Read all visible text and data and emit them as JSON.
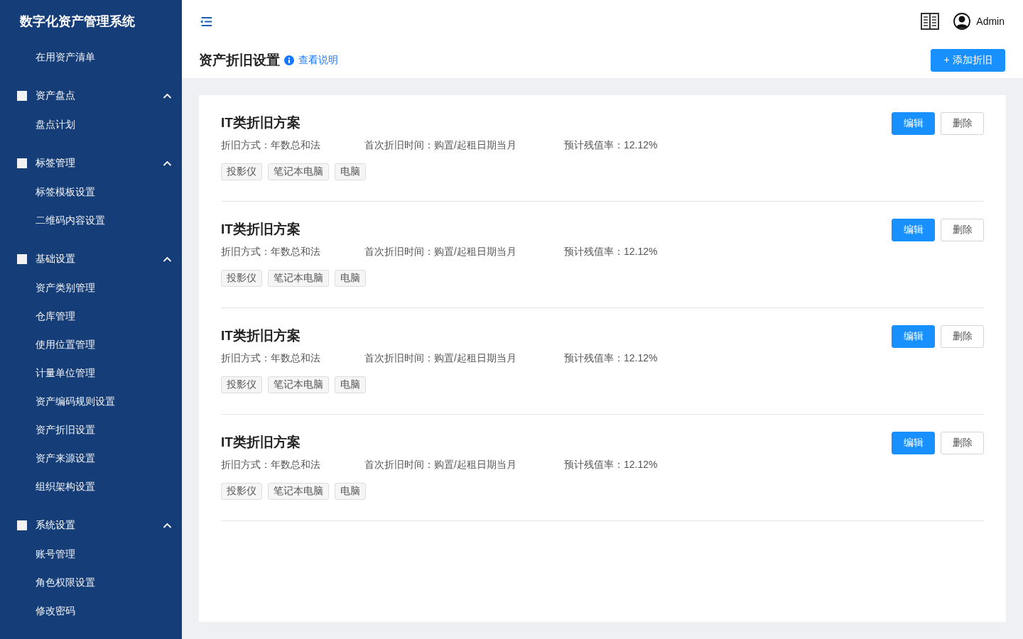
{
  "sidebar": {
    "title": "数字化资产管理系统",
    "items": [
      {
        "kind": "link",
        "label": "在用资产清单"
      },
      {
        "kind": "group",
        "label": "资产盘点",
        "expanded": true,
        "children": [
          {
            "label": "盘点计划"
          }
        ]
      },
      {
        "kind": "group",
        "label": "标签管理",
        "expanded": true,
        "children": [
          {
            "label": "标签模板设置"
          },
          {
            "label": "二维码内容设置"
          }
        ]
      },
      {
        "kind": "group",
        "label": "基础设置",
        "expanded": true,
        "children": [
          {
            "label": "资产类别管理"
          },
          {
            "label": "仓库管理"
          },
          {
            "label": "使用位置管理"
          },
          {
            "label": "计量单位管理"
          },
          {
            "label": "资产编码规则设置"
          },
          {
            "label": "资产折旧设置"
          },
          {
            "label": "资产来源设置"
          },
          {
            "label": "组织架构设置"
          }
        ]
      },
      {
        "kind": "group",
        "label": "系统设置",
        "expanded": true,
        "children": [
          {
            "label": "账号管理"
          },
          {
            "label": "角色权限设置"
          },
          {
            "label": "修改密码"
          }
        ]
      }
    ]
  },
  "header": {
    "user": "Admin"
  },
  "page": {
    "title": "资产折旧设置",
    "help_link": "查看说明",
    "add_button": "+ 添加折旧"
  },
  "schemes": [
    {
      "name": "IT类折旧方案",
      "method_label": "折旧方式：",
      "method": "年数总和法",
      "start_label": "首次折旧时间：",
      "start": "购置/起租日期当月",
      "rate_label": "预计残值率：",
      "rate": "12.12%",
      "tags": [
        "投影仪",
        "笔记本电脑",
        "电脑"
      ],
      "edit": "编辑",
      "delete": "删除"
    },
    {
      "name": "IT类折旧方案",
      "method_label": "折旧方式：",
      "method": "年数总和法",
      "start_label": "首次折旧时间：",
      "start": "购置/起租日期当月",
      "rate_label": "预计残值率：",
      "rate": "12.12%",
      "tags": [
        "投影仪",
        "笔记本电脑",
        "电脑"
      ],
      "edit": "编辑",
      "delete": "删除"
    },
    {
      "name": "IT类折旧方案",
      "method_label": "折旧方式：",
      "method": "年数总和法",
      "start_label": "首次折旧时间：",
      "start": "购置/起租日期当月",
      "rate_label": "预计残值率：",
      "rate": "12.12%",
      "tags": [
        "投影仪",
        "笔记本电脑",
        "电脑"
      ],
      "edit": "编辑",
      "delete": "删除"
    },
    {
      "name": "IT类折旧方案",
      "method_label": "折旧方式：",
      "method": "年数总和法",
      "start_label": "首次折旧时间：",
      "start": "购置/起租日期当月",
      "rate_label": "预计残值率：",
      "rate": "12.12%",
      "tags": [
        "投影仪",
        "笔记本电脑",
        "电脑"
      ],
      "edit": "编辑",
      "delete": "删除"
    }
  ]
}
